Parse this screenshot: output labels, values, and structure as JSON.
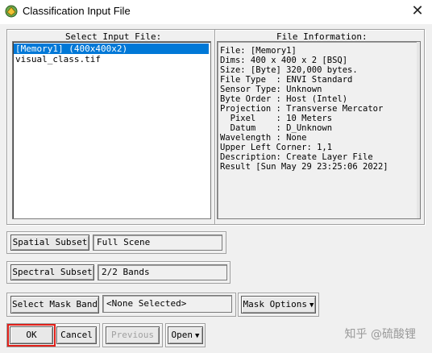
{
  "window": {
    "title": "Classification Input File",
    "close_glyph": "✕"
  },
  "select_panel": {
    "heading": "Select Input File:",
    "items": [
      "[Memory1] (400x400x2)",
      "visual_class.tif"
    ],
    "selected_index": 0
  },
  "info_panel": {
    "heading": "File Information:",
    "lines": [
      "File: [Memory1]",
      "Dims: 400 x 400 x 2 [BSQ]",
      "Size: [Byte] 320,000 bytes.",
      "File Type  : ENVI Standard",
      "Sensor Type: Unknown",
      "Byte Order : Host (Intel)",
      "Projection : Transverse Mercator",
      "  Pixel    : 10 Meters",
      "  Datum    : D_Unknown",
      "Wavelength : None",
      "Upper Left Corner: 1,1",
      "Description: Create Layer File",
      "Result [Sun May 29 23:25:06 2022]"
    ]
  },
  "spatial": {
    "button": "Spatial Subset",
    "value": "Full Scene"
  },
  "spectral": {
    "button": "Spectral Subset",
    "value": "2/2 Bands"
  },
  "mask": {
    "button": "Select Mask Band",
    "value": "<None Selected>",
    "options": "Mask Options"
  },
  "footer": {
    "ok": "OK",
    "cancel": "Cancel",
    "previous": "Previous",
    "open": "Open"
  },
  "watermark": "知乎 @硫酸锂",
  "colors": {
    "selection": "#0078d7",
    "highlight": "#e0201a"
  }
}
